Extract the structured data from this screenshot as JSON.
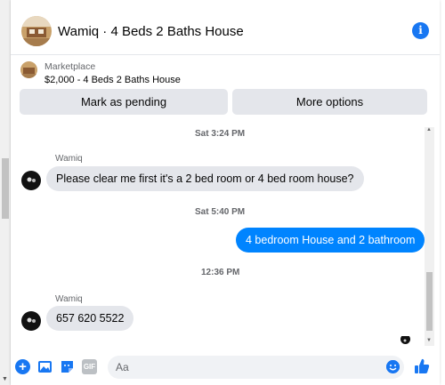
{
  "header": {
    "title": "Wamiq · 4 Beds 2 Baths House",
    "info_icon": "info-icon"
  },
  "marketplace": {
    "label": "Marketplace",
    "listing": "$2,000 - 4 Beds 2 Baths House",
    "mark_pending_label": "Mark as pending",
    "more_options_label": "More options"
  },
  "messages": {
    "timestamps": [
      "Sat 3:24 PM",
      "Sat 5:40 PM",
      "12:36 PM"
    ],
    "sender_name": "Wamiq",
    "msg1": "Please clear me first it's a 2 bed room or 4 bed room house?",
    "msg2": "4 bedroom House and 2 bathroom",
    "msg3": "657 620 5522"
  },
  "composer": {
    "placeholder": "Aa",
    "gif_label": "GIF"
  },
  "colors": {
    "accent": "#1877f2",
    "outgoing_bubble": "#0084ff",
    "incoming_bubble": "#e4e6eb"
  }
}
